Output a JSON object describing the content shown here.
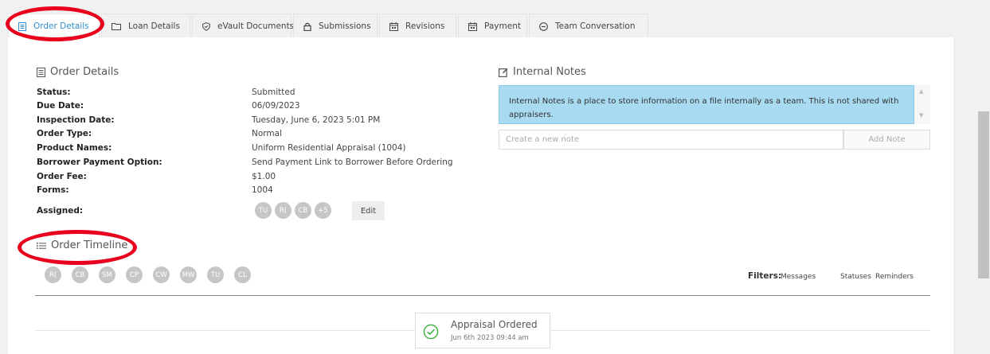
{
  "tabs": [
    {
      "label": "Order Details",
      "icon": "form-icon",
      "active": true
    },
    {
      "label": "Loan Details",
      "icon": "folder-icon"
    },
    {
      "label": "eVault Documents",
      "icon": "shield-icon"
    },
    {
      "label": "Submissions",
      "icon": "lock-icon"
    },
    {
      "label": "Revisions",
      "icon": "calendar-icon"
    },
    {
      "label": "Payment",
      "icon": "calendar-icon"
    },
    {
      "label": "Team Conversation",
      "icon": "chat-icon"
    }
  ],
  "order_details": {
    "title": "Order Details",
    "fields": [
      {
        "label": "Status:",
        "value": "Submitted"
      },
      {
        "label": "Due Date:",
        "value": "06/09/2023"
      },
      {
        "label": "Inspection Date:",
        "value": "Tuesday, June 6, 2023 5:01 PM"
      },
      {
        "label": "Order Type:",
        "value": "Normal"
      },
      {
        "label": "Product Names:",
        "value": "Uniform Residential Appraisal (1004)"
      },
      {
        "label": "Borrower Payment Option:",
        "value": "Send Payment Link to Borrower Before Ordering"
      },
      {
        "label": "Order Fee:",
        "value": "$1.00"
      },
      {
        "label": "Forms:",
        "value": "1004"
      }
    ],
    "assigned_label": "Assigned:",
    "assigned_avatars": [
      "TU",
      "R(",
      "CB",
      "+5"
    ],
    "edit_label": "Edit"
  },
  "internal_notes": {
    "title": "Internal Notes",
    "info": "Internal Notes is a place to store information on a file internally as a team. This is not shared with appraisers.",
    "input_placeholder": "Create a new note",
    "add_button": "Add Note"
  },
  "timeline": {
    "title": "Order Timeline",
    "avatars": [
      "R(",
      "CB",
      "SM",
      "CP",
      "CW",
      "MW",
      "TU",
      "CL"
    ],
    "filters_label": "Filters:",
    "filters": [
      "Messages",
      "Statuses",
      "Reminders"
    ],
    "event": {
      "title": "Appraisal Ordered",
      "time": "Jun 6th 2023 09:44 am"
    }
  },
  "colors": {
    "accent": "#2d8ecf",
    "notes_bg": "#a8daf1",
    "avatar": "#c6c6c6",
    "highlight_ring": "#e8001c",
    "success": "#3cb043"
  }
}
